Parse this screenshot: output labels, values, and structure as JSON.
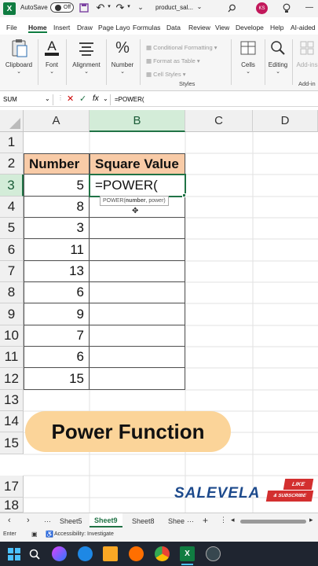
{
  "titlebar": {
    "autosave_label": "AutoSave",
    "toggle_state": "Off",
    "filename": "product_sal...",
    "avatar_initials": "KS"
  },
  "menu": [
    "File",
    "Home",
    "Insert",
    "Draw",
    "Page Layo",
    "Formulas",
    "Data",
    "Review",
    "View",
    "Develope",
    "Help",
    "AI-aided"
  ],
  "ribbon": {
    "clipboard": "Clipboard",
    "font": "Font",
    "alignment": "Alignment",
    "number": "Number",
    "conditional_formatting": "Conditional Formatting",
    "format_as_table": "Format as Table",
    "cell_styles": "Cell Styles",
    "styles_group": "Styles",
    "cells": "Cells",
    "editing": "Editing",
    "addins": "Add-ins",
    "addins_group": "Add-in"
  },
  "formulabar": {
    "name_box": "SUM",
    "fx": "fx",
    "formula": "=POWER("
  },
  "columns": [
    "A",
    "B",
    "C",
    "D"
  ],
  "rows": [
    "1",
    "2",
    "3",
    "4",
    "5",
    "6",
    "7",
    "8",
    "9",
    "10",
    "11",
    "12",
    "13",
    "14",
    "15",
    "17",
    "18"
  ],
  "table": {
    "header_number": "Number",
    "header_square": "Square Value",
    "active_formula": "=POWER(",
    "values": [
      "5",
      "8",
      "3",
      "11",
      "13",
      "6",
      "9",
      "7",
      "6",
      "15"
    ]
  },
  "tooltip": {
    "func": "POWER(",
    "arg1": "number",
    "rest": ", power)"
  },
  "banner": "Power Function",
  "brand": "SALEVELA",
  "like_badge": "LIKE",
  "subscribe_badge": "& SUBSCRIBE",
  "sheets": [
    "Sheet5",
    "Sheet9",
    "Sheet8",
    "Shee"
  ],
  "status": {
    "mode": "Enter",
    "accessibility": "Accessibility: Investigate"
  },
  "colors": {
    "excel_green": "#217346",
    "header_fill": "#f8cba7",
    "banner_fill": "#fbd499"
  }
}
